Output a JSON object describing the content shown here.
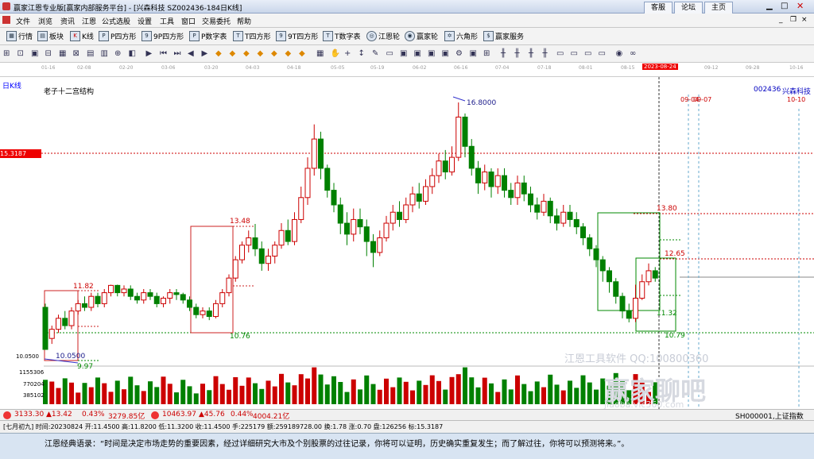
{
  "titlebar": {
    "app_title": "赢家江恩专业版[赢家内部服务平台] - [兴森科技  SZ002436-184日K线]",
    "buttons": [
      "客服",
      "论坛",
      "主页"
    ]
  },
  "menu": [
    "文件",
    "浏览",
    "资讯",
    "江恩",
    "公式选股",
    "设置",
    "工具",
    "窗口",
    "交易委托",
    "帮助"
  ],
  "toolbar1": [
    {
      "label": "行情",
      "icon": "grid-icon"
    },
    {
      "label": "板块",
      "icon": "blocks-icon"
    },
    {
      "label": "K线",
      "icon": "kline-icon"
    },
    {
      "label": "P四方形",
      "icon": "p-square-icon"
    },
    {
      "label": "9P四方形",
      "icon": "9p-square-icon"
    },
    {
      "label": "P数字表",
      "icon": "p-table-icon"
    },
    {
      "label": "T四方形",
      "icon": "t-square-icon"
    },
    {
      "label": "9T四方形",
      "icon": "9t-square-icon"
    },
    {
      "label": "T数字表",
      "icon": "t-table-icon"
    },
    {
      "label": "江恩轮",
      "icon": "gann-wheel-icon"
    },
    {
      "label": "赢家轮",
      "icon": "winner-wheel-icon"
    },
    {
      "label": "六角形",
      "icon": "hexagon-icon"
    },
    {
      "label": "赢家服务",
      "icon": "service-icon"
    }
  ],
  "date_axis": [
    "01-16",
    "02-08",
    "02-20",
    "03-06",
    "03-20",
    "04-03",
    "04-18",
    "05-05",
    "05-19",
    "06-02",
    "06-16",
    "07-04",
    "07-18",
    "08-01",
    "08-15",
    "2023-08-24",
    "09-12",
    "09-28",
    "10-16"
  ],
  "chart": {
    "period_label": "日K线",
    "structure_title": "老子十二宫结构",
    "stock_code": "002436",
    "stock_name": "兴森科技",
    "cursor_date": "2023-08-24",
    "marker_dates_left": "09-04",
    "marker_dates_mid": "09-07",
    "marker_dates_right": "10-10",
    "price_tag": "15.3187",
    "labels": {
      "high": "16.8000",
      "low": "10.0500",
      "box1_top": "11.82",
      "box1_bottom": "9.97",
      "box2_top": "13.48",
      "box2_bottom": "10.76",
      "box3_top": "13.80",
      "box3_mid": "12.65",
      "box3_bottom": "10.79",
      "box3_inner": "11.32"
    },
    "left_axis_price": "10.0500",
    "volume_axis": [
      "1155306",
      "770204",
      "385102"
    ],
    "watermark1": "江恩工具软件 QQ:100800360",
    "watermark2": "赢家聊吧",
    "watermark3": "jiaoba.vic360.com"
  },
  "statusbar": {
    "sh_index": "3133.30",
    "sh_change": "▲13.42",
    "sh_pct": "0.43%",
    "sh_amount": "3279.85亿",
    "sz_index": "10463.97",
    "sz_change": "▲45.76",
    "sz_pct": "0.44%",
    "sz_amount": "4004.21亿",
    "right_label": "SH000001,上证指数"
  },
  "infobar": "[七月初九] 时间:20230824 开:11.4500 高:11.8200 低:11.3200 收:11.4500 手:225179 额:259189728.00 换:1.78 涨:0.70 盘:126256 标:15.3187",
  "quote": "江恩经典语录：“时间是决定市场走势的重要因素，经过详细研究大市及个别股票的过往记录，你将可以证明，历史确实重复发生；而了解过往，你将可以预测将来。”。",
  "candles": [
    [
      11.2,
      10.05,
      11.3,
      10.05
    ],
    [
      10.35,
      10.6,
      10.7,
      10.2
    ],
    [
      10.6,
      10.9,
      11.0,
      10.5
    ],
    [
      10.9,
      10.7,
      11.1,
      10.6
    ],
    [
      10.7,
      11.1,
      11.2,
      10.6
    ],
    [
      11.1,
      11.3,
      11.4,
      11.0
    ],
    [
      11.3,
      11.2,
      11.5,
      11.1
    ],
    [
      11.2,
      11.5,
      11.6,
      11.1
    ],
    [
      11.5,
      11.3,
      11.6,
      11.2
    ],
    [
      11.3,
      11.6,
      11.7,
      11.2
    ],
    [
      11.6,
      11.8,
      11.82,
      11.5
    ],
    [
      11.8,
      11.6,
      11.82,
      11.5
    ],
    [
      11.6,
      11.7,
      11.8,
      11.5
    ],
    [
      11.7,
      11.5,
      11.8,
      11.4
    ],
    [
      11.5,
      11.4,
      11.6,
      11.3
    ],
    [
      11.4,
      11.6,
      11.7,
      11.3
    ],
    [
      11.6,
      11.5,
      11.7,
      11.4
    ],
    [
      11.5,
      11.3,
      11.6,
      11.2
    ],
    [
      11.3,
      11.45,
      11.5,
      11.2
    ],
    [
      11.45,
      11.6,
      11.7,
      11.3
    ],
    [
      11.6,
      11.55,
      11.7,
      11.4
    ],
    [
      11.55,
      11.4,
      11.6,
      11.3
    ],
    [
      11.4,
      11.2,
      11.5,
      11.1
    ],
    [
      11.2,
      11.0,
      11.3,
      10.9
    ],
    [
      11.0,
      11.1,
      11.2,
      10.9
    ],
    [
      11.1,
      10.95,
      11.2,
      10.85
    ],
    [
      10.95,
      11.3,
      11.4,
      10.9
    ],
    [
      11.3,
      11.6,
      11.7,
      11.2
    ],
    [
      11.6,
      12.0,
      12.1,
      11.5
    ],
    [
      12.0,
      12.5,
      12.6,
      11.9
    ],
    [
      12.5,
      12.9,
      13.0,
      12.4
    ],
    [
      12.9,
      13.1,
      13.3,
      12.7
    ],
    [
      13.1,
      12.8,
      13.48,
      12.6
    ],
    [
      12.8,
      12.4,
      13.0,
      12.2
    ],
    [
      12.4,
      12.6,
      12.8,
      12.2
    ],
    [
      12.6,
      12.9,
      13.0,
      12.4
    ],
    [
      12.9,
      13.3,
      13.5,
      12.8
    ],
    [
      13.3,
      13.0,
      13.6,
      12.9
    ],
    [
      13.0,
      13.6,
      13.8,
      12.9
    ],
    [
      13.6,
      14.2,
      14.5,
      13.5
    ],
    [
      14.2,
      15.0,
      15.3,
      14.0
    ],
    [
      15.0,
      15.8,
      16.2,
      14.8
    ],
    [
      15.8,
      15.0,
      16.0,
      14.7
    ],
    [
      15.0,
      14.4,
      15.1,
      14.2
    ],
    [
      14.4,
      14.0,
      14.6,
      13.8
    ],
    [
      14.0,
      13.5,
      14.2,
      13.2
    ],
    [
      13.5,
      13.2,
      13.8,
      12.9
    ],
    [
      13.2,
      13.6,
      13.9,
      13.0
    ],
    [
      13.6,
      13.4,
      13.9,
      13.2
    ],
    [
      13.4,
      13.0,
      13.6,
      12.6
    ],
    [
      13.0,
      12.7,
      13.2,
      12.3
    ],
    [
      12.7,
      13.1,
      13.3,
      12.6
    ],
    [
      13.1,
      13.5,
      13.7,
      13.0
    ],
    [
      13.5,
      13.8,
      14.0,
      13.3
    ],
    [
      13.8,
      13.6,
      14.1,
      13.4
    ],
    [
      13.6,
      14.0,
      14.2,
      13.5
    ],
    [
      14.0,
      14.3,
      14.5,
      13.8
    ],
    [
      14.3,
      14.1,
      14.6,
      13.9
    ],
    [
      14.1,
      14.5,
      14.7,
      14.0
    ],
    [
      14.5,
      14.8,
      15.0,
      14.3
    ],
    [
      14.8,
      15.2,
      15.4,
      14.6
    ],
    [
      15.2,
      14.9,
      15.5,
      14.7
    ],
    [
      14.9,
      15.3,
      15.6,
      14.8
    ],
    [
      15.3,
      16.4,
      16.8,
      15.2
    ],
    [
      16.4,
      15.6,
      16.5,
      15.3
    ],
    [
      15.6,
      15.0,
      15.8,
      14.8
    ],
    [
      15.0,
      14.6,
      15.2,
      14.3
    ],
    [
      14.6,
      14.9,
      15.1,
      14.4
    ],
    [
      14.9,
      14.5,
      15.0,
      14.2
    ],
    [
      14.5,
      14.8,
      15.0,
      14.3
    ],
    [
      14.8,
      14.4,
      15.0,
      14.2
    ],
    [
      14.4,
      14.2,
      14.6,
      14.0
    ],
    [
      14.2,
      14.6,
      14.8,
      14.0
    ],
    [
      14.6,
      14.3,
      14.8,
      14.1
    ],
    [
      14.3,
      14.0,
      14.5,
      13.8
    ],
    [
      14.0,
      13.8,
      14.2,
      13.6
    ],
    [
      13.8,
      14.1,
      14.3,
      13.7
    ],
    [
      14.1,
      13.7,
      14.2,
      13.5
    ],
    [
      13.7,
      13.5,
      13.9,
      13.3
    ],
    [
      13.5,
      13.8,
      14.0,
      13.4
    ],
    [
      13.8,
      13.6,
      14.0,
      13.4
    ],
    [
      13.6,
      13.4,
      13.8,
      13.2
    ],
    [
      13.4,
      13.1,
      13.5,
      12.9
    ],
    [
      13.1,
      12.8,
      13.2,
      12.6
    ],
    [
      12.8,
      12.5,
      12.9,
      12.3
    ],
    [
      12.5,
      12.2,
      12.6,
      11.9
    ],
    [
      12.2,
      11.9,
      12.3,
      11.6
    ],
    [
      11.9,
      11.5,
      12.0,
      11.3
    ],
    [
      11.5,
      11.1,
      11.6,
      10.9
    ],
    [
      11.1,
      10.9,
      11.3,
      10.79
    ],
    [
      10.9,
      11.45,
      11.82,
      10.8
    ],
    [
      11.45,
      11.9,
      12.1,
      11.4
    ],
    [
      11.9,
      12.2,
      12.4,
      11.8
    ],
    [
      12.2,
      12.0,
      12.3,
      11.9
    ]
  ]
}
